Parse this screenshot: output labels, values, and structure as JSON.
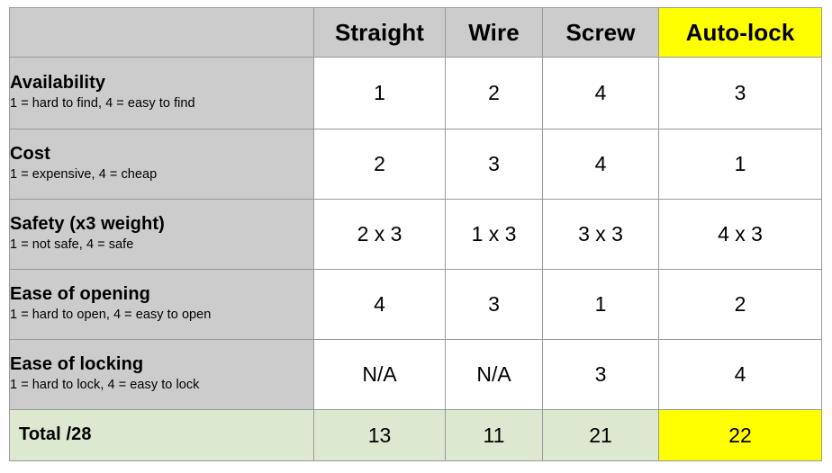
{
  "table": {
    "criterion_header": "",
    "options": [
      {
        "label": "Straight",
        "highlight": false
      },
      {
        "label": "Wire",
        "highlight": false
      },
      {
        "label": "Screw",
        "highlight": false
      },
      {
        "label": "Auto-lock",
        "highlight": true
      }
    ],
    "rows": [
      {
        "title": "Availability",
        "scale": "1 = hard to find, 4 = easy to find",
        "values": [
          "1",
          "2",
          "4",
          "3"
        ]
      },
      {
        "title": "Cost",
        "scale": "1 = expensive, 4 = cheap",
        "values": [
          "2",
          "3",
          "4",
          "1"
        ]
      },
      {
        "title": "Safety (x3 weight)",
        "scale": "1 = not safe, 4 = safe",
        "values": [
          "2 x 3",
          "1 x 3",
          "3 x 3",
          "4 x 3"
        ]
      },
      {
        "title": "Ease of opening",
        "scale": "1 = hard to open, 4 = easy to open",
        "values": [
          "4",
          "3",
          "1",
          "2"
        ]
      },
      {
        "title": "Ease of locking",
        "scale": "1 = hard to lock, 4 = easy to lock",
        "values": [
          "N/A",
          "N/A",
          "3",
          "4"
        ]
      }
    ],
    "total": {
      "title": "Total /28",
      "values": [
        "13",
        "11",
        "21",
        "22"
      ]
    }
  },
  "colors": {
    "header_gray": "#cccccc",
    "highlight_yellow": "#ffff00",
    "total_green": "#dce9d0",
    "border_gray": "#999999",
    "cell_white": "#ffffff"
  }
}
